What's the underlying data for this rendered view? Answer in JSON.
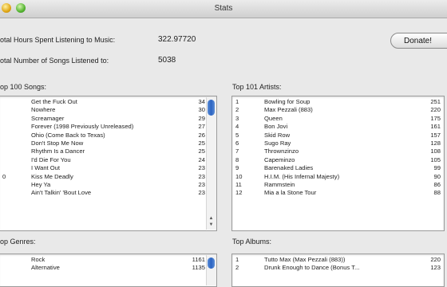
{
  "window": {
    "title": "Stats"
  },
  "stats": {
    "hours_label": "otal Hours Spent Listening to Music:",
    "hours_value": "322.97720",
    "songs_label": "otal Number of Songs Listened to:",
    "songs_value": "5038"
  },
  "donate_label": "Donate!",
  "top_songs": {
    "label": "op 100 Songs:",
    "rows": [
      {
        "num": "",
        "name": "Get the Fuck Out",
        "count": "34"
      },
      {
        "num": "",
        "name": "Nowhere",
        "count": "30"
      },
      {
        "num": "",
        "name": "Screamager",
        "count": "29"
      },
      {
        "num": "",
        "name": "Forever (1998 Previously Unreleased)",
        "count": "27"
      },
      {
        "num": "",
        "name": "Ohio (Come Back to Texas)",
        "count": "26"
      },
      {
        "num": "",
        "name": "Don't Stop Me Now",
        "count": "25"
      },
      {
        "num": "",
        "name": "Rhythm Is a Dancer",
        "count": "25"
      },
      {
        "num": "",
        "name": "I'd Die For You",
        "count": "24"
      },
      {
        "num": "",
        "name": "I Want Out",
        "count": "23"
      },
      {
        "num": "0",
        "name": "Kiss Me Deadly",
        "count": "23"
      },
      {
        "num": "",
        "name": "Hey Ya",
        "count": "23"
      },
      {
        "num": "",
        "name": "Ain't Talkin' 'Bout Love",
        "count": "23"
      }
    ]
  },
  "top_artists": {
    "label": "Top 101 Artists:",
    "rows": [
      {
        "num": "1",
        "name": "Bowling for Soup",
        "count": "251"
      },
      {
        "num": "2",
        "name": "Max Pezzali (883)",
        "count": "220"
      },
      {
        "num": "3",
        "name": "Queen",
        "count": "175"
      },
      {
        "num": "4",
        "name": "Bon Jovi",
        "count": "161"
      },
      {
        "num": "5",
        "name": "Skid Row",
        "count": "157"
      },
      {
        "num": "6",
        "name": "Sugo Ray",
        "count": "128"
      },
      {
        "num": "7",
        "name": "Thrownzinzo",
        "count": "108"
      },
      {
        "num": "8",
        "name": "Capeminzo",
        "count": "105"
      },
      {
        "num": "9",
        "name": "Barenaked Ladies",
        "count": "99"
      },
      {
        "num": "10",
        "name": "H.I.M. (His Infernal Majesty)",
        "count": "90"
      },
      {
        "num": "11",
        "name": "Rammstein",
        "count": "86"
      },
      {
        "num": "12",
        "name": "Mia a la Stone Tour",
        "count": "88"
      }
    ]
  },
  "top_genres": {
    "label": "op Genres:",
    "rows": [
      {
        "num": "",
        "name": "Rock",
        "count": "1161"
      },
      {
        "num": "",
        "name": "Alternative",
        "count": "1135"
      }
    ]
  },
  "top_albums": {
    "label": "Top Albums:",
    "rows": [
      {
        "num": "1",
        "name": "Tutto Max (Max Pezzali (883))",
        "count": "220"
      },
      {
        "num": "2",
        "name": "Drunk Enough to Dance (Bonus T...",
        "count": "123"
      }
    ]
  }
}
